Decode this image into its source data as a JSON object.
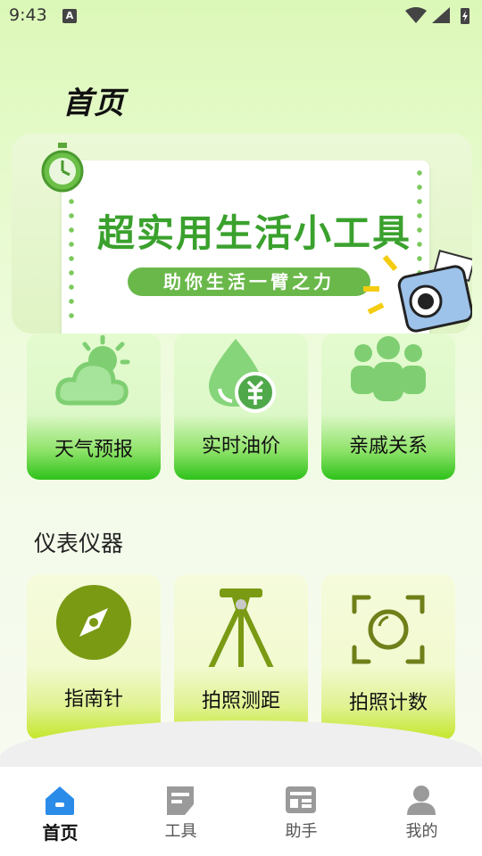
{
  "status": {
    "time": "9:43",
    "badge": "A"
  },
  "header": {
    "title": "首页"
  },
  "banner": {
    "headline": "超实用生活小工具",
    "pill": "助你生活一臂之力"
  },
  "life_tools": [
    {
      "label": "天气预报",
      "icon": "weather-icon"
    },
    {
      "label": "实时油价",
      "icon": "oil-price-icon"
    },
    {
      "label": "亲戚关系",
      "icon": "relatives-icon"
    }
  ],
  "instruments": {
    "title": "仪表仪器",
    "items": [
      {
        "label": "指南针",
        "icon": "compass-icon"
      },
      {
        "label": "拍照测距",
        "icon": "tripod-icon"
      },
      {
        "label": "拍照计数",
        "icon": "camera-count-icon"
      }
    ]
  },
  "tabs": [
    {
      "label": "首页",
      "icon": "home-icon",
      "active": true
    },
    {
      "label": "工具",
      "icon": "tools-icon",
      "active": false
    },
    {
      "label": "助手",
      "icon": "assistant-icon",
      "active": false
    },
    {
      "label": "我的",
      "icon": "profile-icon",
      "active": false
    }
  ],
  "colors": {
    "accent": "#3aa12d",
    "tab_active": "#2b8be8",
    "tab_inactive": "#9a9a9a"
  }
}
